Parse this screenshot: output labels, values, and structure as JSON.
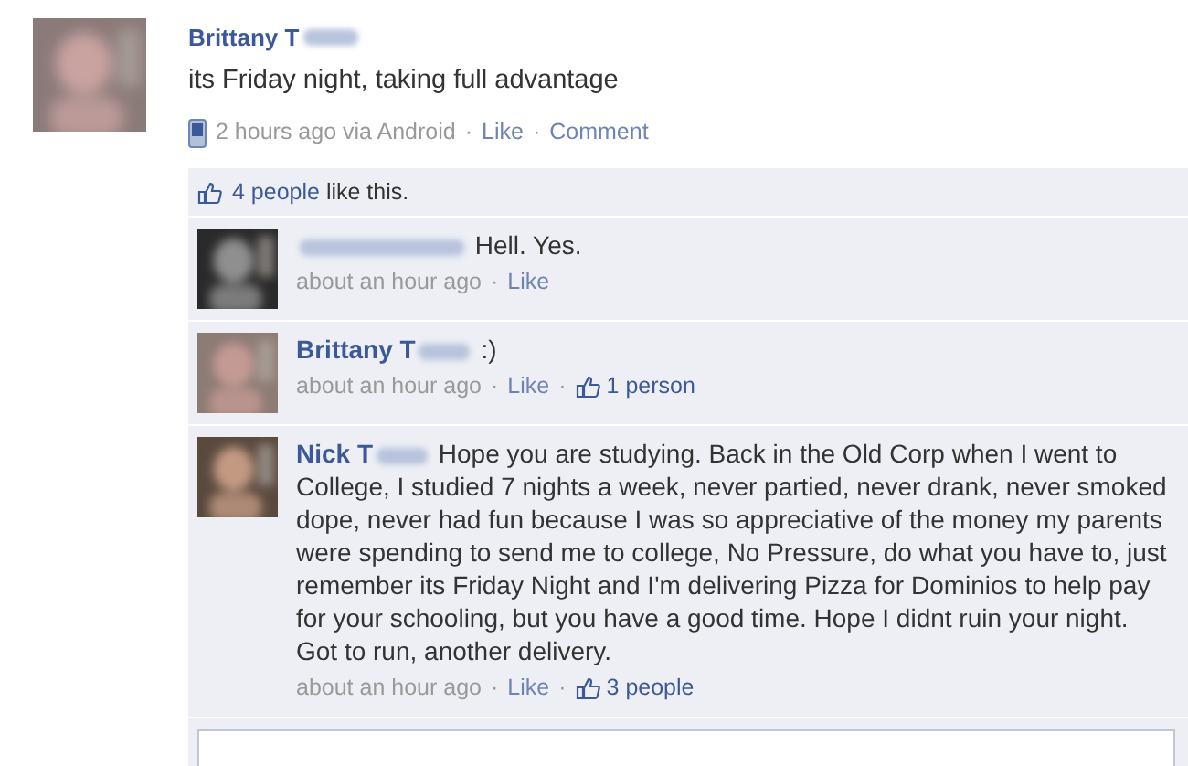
{
  "post": {
    "author": "Brittany T",
    "name_redacted": true,
    "text": "its Friday night, taking full advantage",
    "meta": [
      {
        "kind": "device"
      },
      {
        "kind": "time",
        "text": "2 hours ago via Android"
      },
      {
        "kind": "sep",
        "text": "·"
      },
      {
        "kind": "link",
        "text": "Like"
      },
      {
        "kind": "sep",
        "text": "·"
      },
      {
        "kind": "link",
        "text": "Comment"
      }
    ]
  },
  "likes": {
    "count": "4 people",
    "suffix": "like this."
  },
  "comments": [
    {
      "name_redacted": true,
      "text": "Hell. Yes.",
      "meta": [
        {
          "kind": "time",
          "text": "about an hour ago"
        },
        {
          "kind": "sep",
          "text": "·"
        },
        {
          "kind": "link",
          "text": "Like"
        }
      ]
    },
    {
      "author": "Brittany T",
      "name_redacted": true,
      "text": ":)",
      "meta": [
        {
          "kind": "time",
          "text": "about an hour ago"
        },
        {
          "kind": "sep",
          "text": "·"
        },
        {
          "kind": "link",
          "text": "Like"
        },
        {
          "kind": "sep",
          "text": "·"
        },
        {
          "kind": "likes",
          "text": "1 person"
        }
      ]
    },
    {
      "author": "Nick T",
      "name_redacted": true,
      "text": "Hope you are studying. Back in the Old Corp when I went to College, I studied 7 nights a week, never partied, never drank, never smoked dope, never had fun because I was so appreciative of the money my parents were spending to send me to college, No Pressure, do what you have to, just remember its Friday Night and I'm delivering Pizza for Dominios to help pay for your schooling, but you have a good time. Hope I didnt ruin your night. Got to run, another delivery.",
      "meta": [
        {
          "kind": "time",
          "text": "about an hour ago"
        },
        {
          "kind": "sep",
          "text": "·"
        },
        {
          "kind": "link",
          "text": "Like"
        },
        {
          "kind": "sep",
          "text": "·"
        },
        {
          "kind": "likes",
          "text": "3 people"
        }
      ]
    }
  ]
}
